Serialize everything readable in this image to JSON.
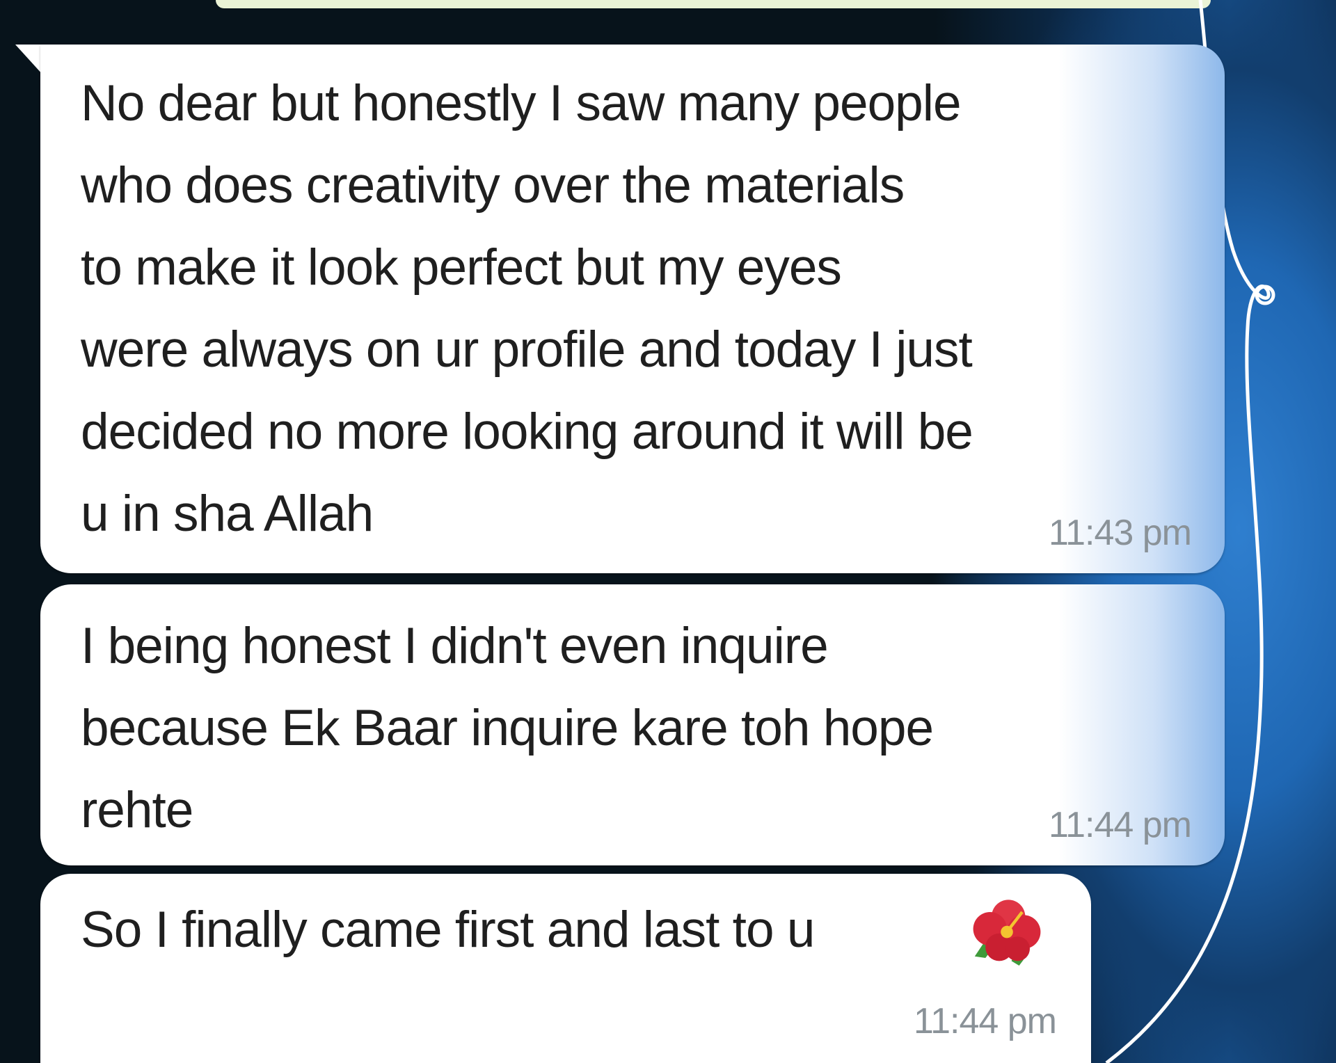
{
  "messages": [
    {
      "text": "No dear but honestly I saw many people\nwho does creativity over the materials\nto make it look perfect but my eyes\nwere always on ur profile and today I just\ndecided no more looking around it will be\nu in sha Allah",
      "time": "11:43 pm"
    },
    {
      "text": "I being honest I didn't even inquire\nbecause Ek Baar inquire kare toh hope\nrehte",
      "time": "11:44 pm"
    },
    {
      "text": "So I finally came first and last to u",
      "emoji": "hibiscus-icon",
      "time": "11:44 pm"
    }
  ],
  "colors": {
    "bubble": "#ffffff",
    "text": "#1f1f1f",
    "timestamp": "#8a9298",
    "background_dark": "#06131c",
    "background_blue": "#1f67b3",
    "flower": "#d8283a"
  }
}
